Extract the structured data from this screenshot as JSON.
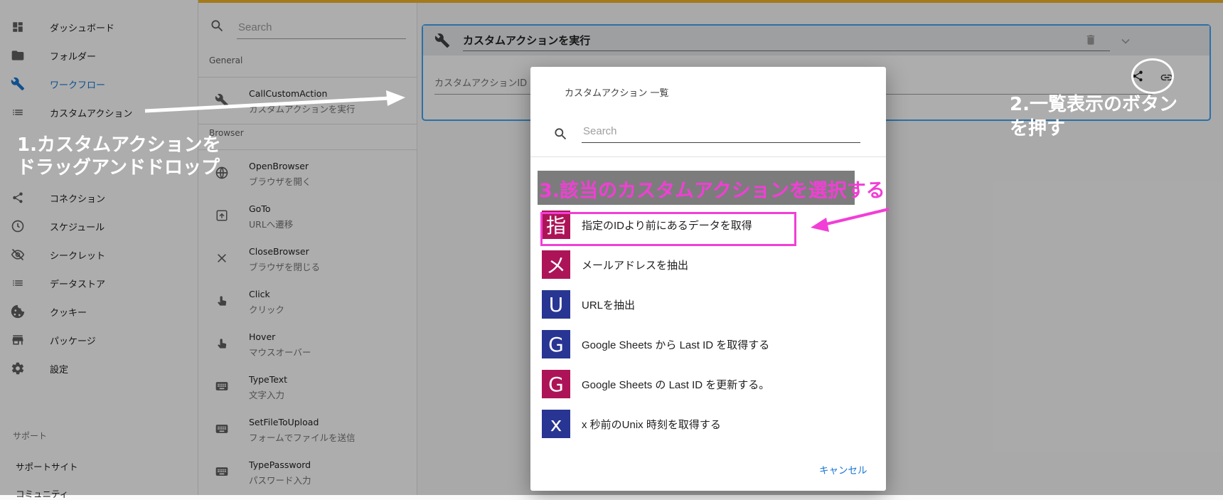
{
  "sidebar": {
    "items": [
      {
        "label": "ダッシュボード",
        "icon": "dashboard-icon"
      },
      {
        "label": "フォルダー",
        "icon": "folder-icon"
      },
      {
        "label": "ワークフロー",
        "icon": "wrench-icon",
        "active": true
      },
      {
        "label": "カスタムアクション",
        "icon": "list-icon"
      },
      {
        "label": "コネクション",
        "icon": "share-icon"
      },
      {
        "label": "スケジュール",
        "icon": "clock-icon"
      },
      {
        "label": "シークレット",
        "icon": "eye-off-icon"
      },
      {
        "label": "データストア",
        "icon": "list-icon"
      },
      {
        "label": "クッキー",
        "icon": "cookie-icon"
      },
      {
        "label": "パッケージ",
        "icon": "store-icon"
      },
      {
        "label": "設定",
        "icon": "gear-icon"
      }
    ],
    "support_heading": "サポート",
    "support_links": [
      "サポートサイト",
      "コミュニティ"
    ]
  },
  "palette": {
    "search_placeholder": "Search",
    "section_general": "General",
    "section_browser": "Browser",
    "general_items": [
      {
        "name": "CallCustomAction",
        "desc": "カスタムアクションを実行",
        "icon": "wrench-icon"
      }
    ],
    "browser_items": [
      {
        "name": "OpenBrowser",
        "desc": "ブラウザを開く",
        "icon": "globe-icon"
      },
      {
        "name": "GoTo",
        "desc": "URLへ遷移",
        "icon": "open-in-icon"
      },
      {
        "name": "CloseBrowser",
        "desc": "ブラウザを閉じる",
        "icon": "close-icon"
      },
      {
        "name": "Click",
        "desc": "クリック",
        "icon": "touch-icon"
      },
      {
        "name": "Hover",
        "desc": "マウスオーバー",
        "icon": "touch-icon"
      },
      {
        "name": "TypeText",
        "desc": "文字入力",
        "icon": "keyboard-icon"
      },
      {
        "name": "SetFileToUpload",
        "desc": "フォームでファイルを送信",
        "icon": "keyboard-icon"
      },
      {
        "name": "TypePassword",
        "desc": "パスワード入力",
        "icon": "keyboard-icon"
      }
    ]
  },
  "workflow": {
    "step_title": "カスタムアクションを実行",
    "field_label": "カスタムアクションID"
  },
  "dialog": {
    "title": "カスタムアクション 一覧",
    "search_placeholder": "Search",
    "items": [
      {
        "avatar": "指",
        "label": "指定のIDより前にあるデータを取得",
        "color": "#ad1457"
      },
      {
        "avatar": "メ",
        "label": "メールアドレスを抽出",
        "color": "#ad1457"
      },
      {
        "avatar": "U",
        "label": "URLを抽出",
        "color": "#283593"
      },
      {
        "avatar": "G",
        "label": "Google Sheets から Last ID を取得する",
        "color": "#283593"
      },
      {
        "avatar": "G",
        "label": "Google Sheets の Last ID を更新する。",
        "color": "#ad1457"
      },
      {
        "avatar": "x",
        "label": "x 秒前のUnix 時刻を取得する",
        "color": "#283593"
      }
    ],
    "cancel_label": "キャンセル"
  },
  "annotations": {
    "step1": "1.カスタムアクションを\nドラッグアンドドロップ",
    "step2": "2.一覧表示のボタン\nを押す",
    "step3": "3.該当のカスタムアクションを選択する",
    "highlight_color": "#f23ed6"
  },
  "colors": {
    "accent": "#1976d2",
    "topbar": "#f0b429",
    "card_border": "#42a5f5"
  }
}
